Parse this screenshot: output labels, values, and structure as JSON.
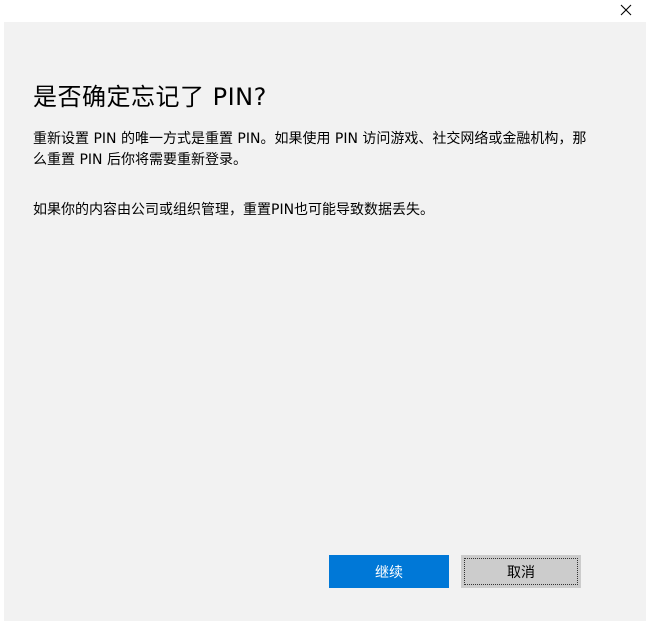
{
  "dialog": {
    "title": "是否确定忘记了 PIN?",
    "paragraph1": "重新设置 PIN 的唯一方式是重置 PIN。如果使用 PIN 访问游戏、社交网络或金融机构，那么重置 PIN 后你将需要重新登录。",
    "paragraph2": "如果你的内容由公司或组织管理，重置PIN也可能导致数据丢失。",
    "continue_label": "继续",
    "cancel_label": "取消"
  },
  "icons": {
    "close": "close-icon"
  },
  "colors": {
    "primary": "#0078d7",
    "secondary": "#cccccc",
    "background": "#f2f2f2"
  }
}
